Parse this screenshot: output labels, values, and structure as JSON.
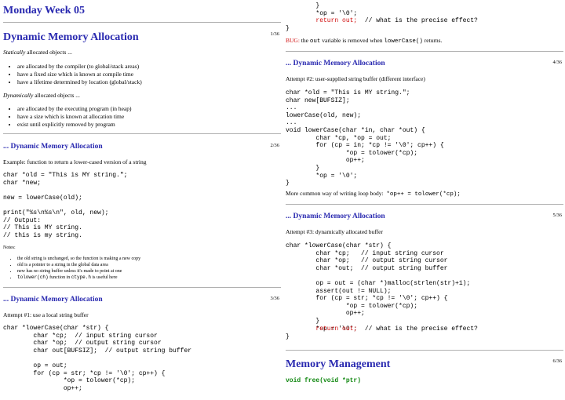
{
  "week_title": "Monday Week 05",
  "slide1": {
    "title": "Dynamic Memory Allocation",
    "page": "1/36",
    "static_intro_em": "Statically",
    "static_intro_rest": " allocated objects ...",
    "static_items": [
      "are allocated by the compiler (to global/stack areas)",
      "have a fixed size which is known at compile time",
      "have a lifetime determined by location (global/stack)"
    ],
    "dynamic_intro_em": "Dynamically",
    "dynamic_intro_rest": " allocated objects ...",
    "dynamic_items": [
      "are allocated by the executing program (in heap)",
      "have a size which is known at allocation time",
      "exist until explicitly removed by program"
    ]
  },
  "slide2": {
    "title": "... Dynamic Memory Allocation",
    "page": "2/36",
    "intro": "Example: function to return a lower-cased version of a string",
    "code": "char *old = \"This is MY string.\";\nchar *new;\n\nnew = lowerCase(old);\n\nprint(\"%s\\n%s\\n\", old, new);\n// Output:\n// This is MY string.\n// this is my string.",
    "notes_label": "Notes:",
    "notes": [
      "the old string is unchanged, so the function is making a new copy",
      "old is a pointer to a string in the global data area",
      "new has no string buffer unless it's made to point at one"
    ],
    "note4_code": "tolower(ch)",
    "note4_mid": " function in ",
    "note4_code2": "ctype.h",
    "note4_end": " is useful here"
  },
  "slide3": {
    "title": "... Dynamic Memory Allocation",
    "page": "3/36",
    "intro": "Attempt #1: use a local string buffer",
    "code": "char *lowerCase(char *str) {\n        char *cp;  // input string cursor\n        char *op;  // output string cursor\n        char out[BUFSIZ];  // output string buffer\n\n        op = out;\n        for (cp = str; *cp != '\\0'; cp++) {\n                *op = tolower(*cp);\n                op++;"
  },
  "slide3_cont": {
    "code_a": "        }\n        *op = '\\0';",
    "return_kw": "return out;",
    "return_comment": "  // what is the precise effect?",
    "close": "}",
    "bug_label": "BUG:",
    "bug_pre": " the ",
    "bug_code": "out",
    "bug_mid": " variable is removed when ",
    "bug_code2": "lowerCase()",
    "bug_end": " returns."
  },
  "slide4": {
    "title": "... Dynamic Memory Allocation",
    "page": "4/36",
    "intro": "Attempt #2: user-supplied string buffer (different interface)",
    "code": "char *old = \"This is MY string.\";\nchar new[BUFSIZ];\n...\nlowerCase(old, new);\n...\nvoid lowerCase(char *in, char *out) {\n        char *cp, *op = out;\n        for (cp = in; *cp != '\\0'; cp++) {\n                *op = tolower(*cp);\n                op++;\n        }\n        *op = '\\0';\n}",
    "footer_text": "More common way of writing loop body:",
    "footer_code": "*op++ = tolower(*cp);"
  },
  "slide5": {
    "title": "... Dynamic Memory Allocation",
    "page": "5/36",
    "intro": "Attempt #3: dynamically allocated buffer",
    "code": "char *lowerCase(char *str) {\n        char *cp;   // input string cursor\n        char *op;   // output string cursor\n        char *out;  // output string buffer\n\n        op = out = (char *)malloc(strlen(str)+1);\n        assert(out != NULL);\n        for (cp = str; *cp != '\\0'; cp++) {\n                *op = tolower(*cp);\n                op++;\n        }\n        *op = '\\0';",
    "return_kw": "return out;",
    "return_comment": "  // what is the precise effect?",
    "close": "}"
  },
  "slide6": {
    "title": "Memory Management",
    "page": "6/36",
    "code": "void free(void *ptr)"
  },
  "colors": {
    "heading": "#2a2ab0",
    "keyword": "#d01010",
    "signature": "#118811"
  }
}
